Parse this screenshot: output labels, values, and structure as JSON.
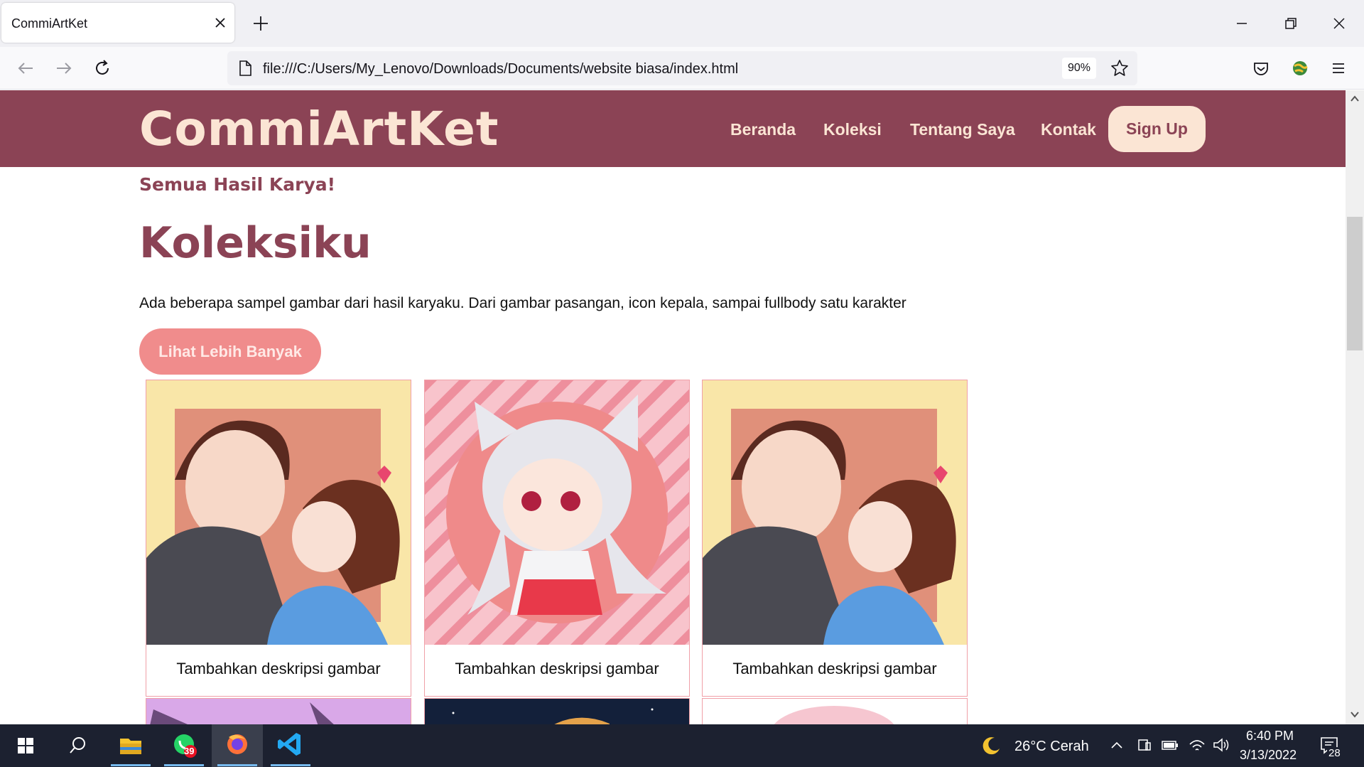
{
  "browser": {
    "tab_title": "CommiArtKet",
    "url": "file:///C:/Users/My_Lenovo/Downloads/Documents/website biasa/index.html",
    "zoom": "90%"
  },
  "site": {
    "logo": "CommiArtKet",
    "nav": [
      "Beranda",
      "Koleksi",
      "Tentang Saya",
      "Kontak"
    ],
    "signup": "Sign Up",
    "subtitle": "Semua Hasil Karya!",
    "heading": "Koleksiku",
    "intro": "Ada beberapa sampel gambar dari hasil karyaku. Dari gambar pasangan, icon kepala, sampai fullbody satu karakter",
    "more_button": "Lihat Lebih Banyak",
    "cards": [
      {
        "caption": "Tambahkan deskripsi gambar",
        "image": "couple-illustration"
      },
      {
        "caption": "Tambahkan deskripsi gambar",
        "image": "chibi-catgirl-illustration"
      },
      {
        "caption": "Tambahkan deskripsi gambar",
        "image": "couple-illustration"
      }
    ],
    "colors": {
      "header": "#8b4355",
      "accent": "#fbe5d4",
      "button": "#f08c8c"
    }
  },
  "taskbar": {
    "whatsapp_badge": "39",
    "weather": "26°C  Cerah",
    "time": "6:40 PM",
    "date": "3/13/2022",
    "notifications": "28"
  }
}
